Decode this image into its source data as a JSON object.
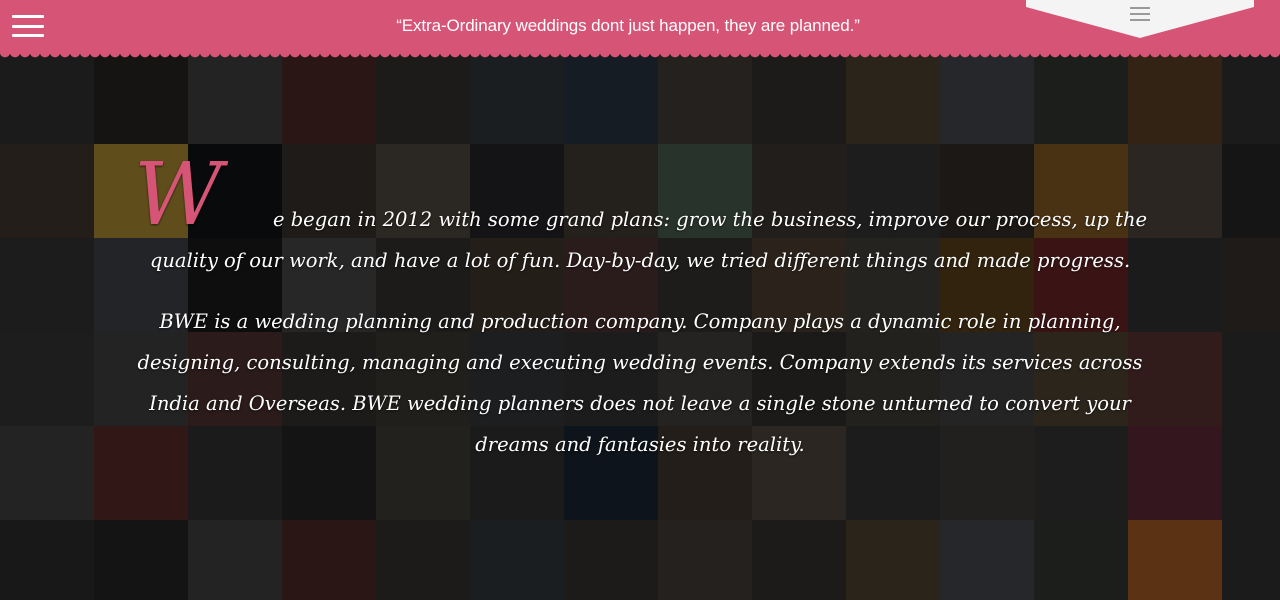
{
  "header": {
    "tagline": "“Extra-Ordinary weddings dont just happen, they are planned.”",
    "menu_icon": "hamburger-menu-icon",
    "tab_icon": "list-icon",
    "bar_color": "#d65475"
  },
  "about": {
    "dropcap": "W",
    "paragraph1_line1": "e began in 2012 with some grand plans: grow the business, improve our process, up the",
    "paragraph1_line2": "quality of our work, and have a lot of fun. Day-by-day, we tried different things and made progress.",
    "paragraph2": "BWE is a wedding planning and production company. Company plays a dynamic role in planning, designing, consulting, managing and executing wedding events. Company extends its services across India and Overseas. BWE wedding planners does not leave a single stone unturned to convert your dreams and fantasies into reality."
  },
  "background": {
    "tile_colors": [
      "#3a3a3a",
      "#2f2b28",
      "#4a4a4a",
      "#5a2e2e",
      "#3c3a36",
      "#3a3f45",
      "#2e3c4a",
      "#4c4540",
      "#3b3935",
      "#5a4d3a",
      "#4f5359",
      "#3b3f3a",
      "#6a4a2a",
      "#3a3a3a",
      "#4a3f36",
      "#c7a43a",
      "#14151a",
      "#3f3a33",
      "#5a5247",
      "#2b2b2f",
      "#4b443c",
      "#556b5a",
      "#45403a",
      "#3d3d3d",
      "#3a332c",
      "#9a6a2a",
      "#5a5048",
      "#2c2c2c",
      "#3c3c3c",
      "#4a4d52",
      "#1e1e1e",
      "#525252",
      "#3b3a38",
      "#4b3f35",
      "#5a3b3b",
      "#3d3b3a",
      "#5a4a3a",
      "#4f4a44",
      "#6a4a1f",
      "#7a2a2a",
      "#3a3a3a",
      "#423a33",
      "#3d3d3d",
      "#4a4a4a",
      "#5a3a3a",
      "#3c3a38",
      "#46413b",
      "#3b3f44",
      "#3c3c3c",
      "#4f4a45",
      "#3a3835",
      "#4a4540",
      "#4b4b4b",
      "#5a4f3b",
      "#6a3a3a",
      "#3a3a3a",
      "#4a4a4a",
      "#6a3030",
      "#3a3a3a",
      "#2b2b2b",
      "#4a4540",
      "#3a3a3a",
      "#1e2a3a",
      "#4a3f38",
      "#5a5047",
      "#3b3b3b",
      "#484440",
      "#3d3d3d",
      "#6b2f3f",
      "#3a3a3a",
      "#333333",
      "#2b2b2b",
      "#4a4a4a",
      "#5a2e2e",
      "#3c3a36",
      "#3a3f45",
      "#3e3a35",
      "#4c4540",
      "#3b3935",
      "#5a4d3a",
      "#4f5359",
      "#3b3f3a",
      "#c06a2a",
      "#3a3a3a"
    ]
  }
}
